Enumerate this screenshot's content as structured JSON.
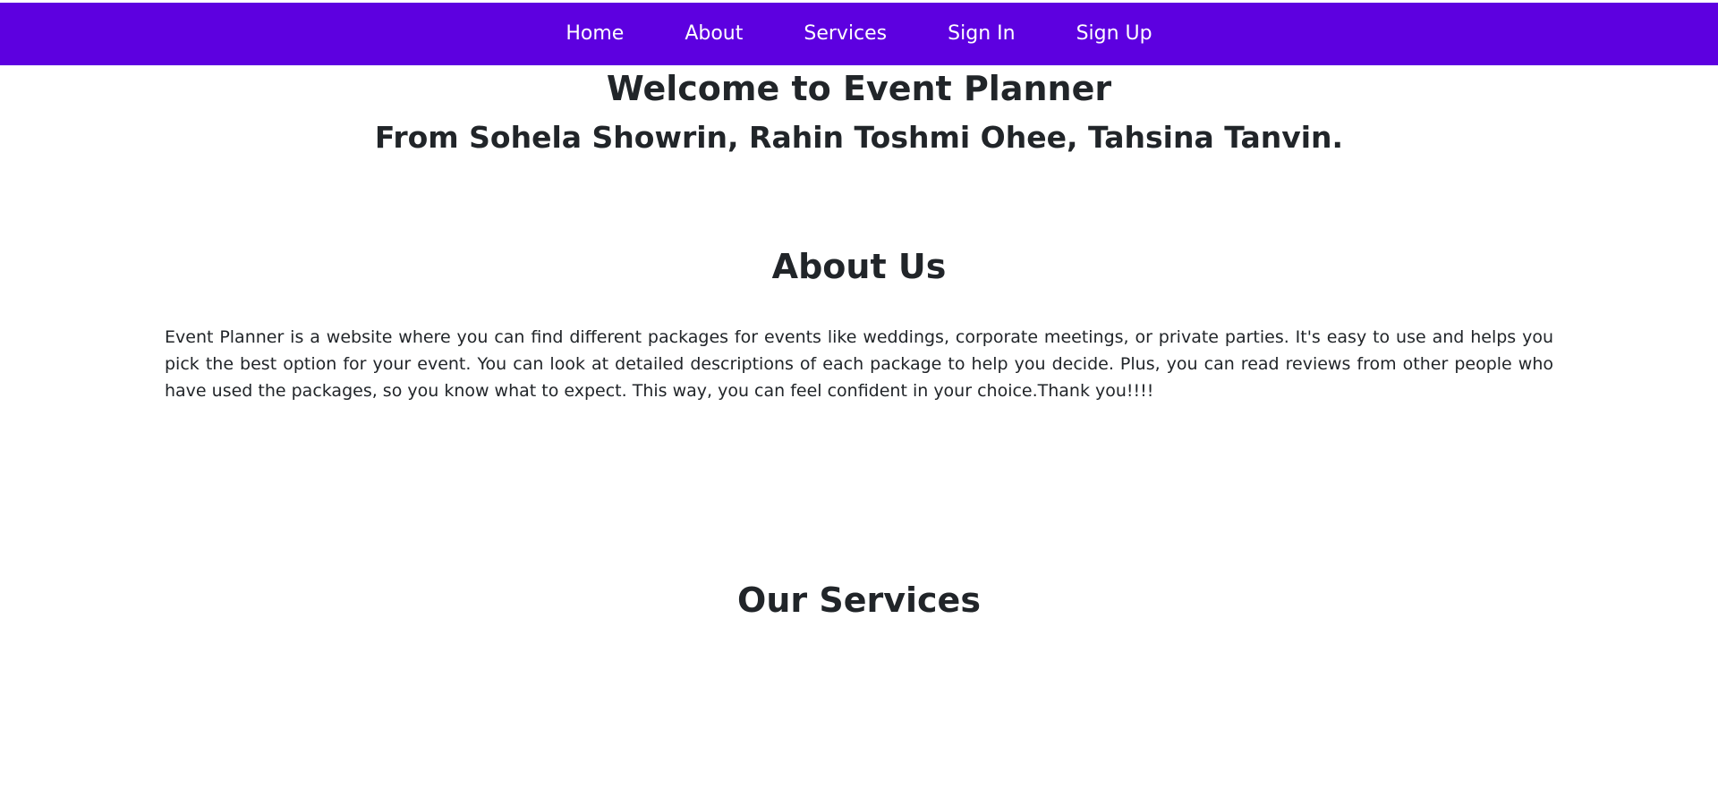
{
  "nav": {
    "items": [
      {
        "label": "Home"
      },
      {
        "label": "About"
      },
      {
        "label": "Services"
      },
      {
        "label": "Sign In"
      },
      {
        "label": "Sign Up"
      }
    ]
  },
  "hero": {
    "title": "Welcome to Event Planner",
    "subtitle": "From Sohela Showrin, Rahin Toshmi Ohee, Tahsina Tanvin."
  },
  "about": {
    "title": "About Us",
    "text": "Event Planner is a website where you can find different packages for events like weddings, corporate meetings, or private parties. It's easy to use and helps you pick the best option for your event. You can look at detailed descriptions of each package to help you decide. Plus, you can read reviews from other people who have used the packages, so you know what to expect. This way, you can feel confident in your choice.Thank you!!!!"
  },
  "services": {
    "title": "Our Services"
  },
  "colors": {
    "navbar": "#5d00e0",
    "nav_text": "#ffffff",
    "text": "#212529"
  }
}
